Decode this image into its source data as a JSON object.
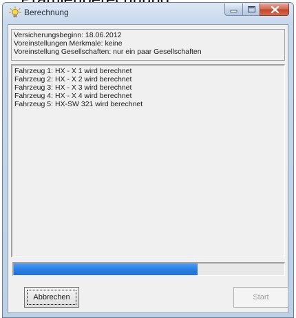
{
  "background": {
    "clipped_title": "Prämienberechnung:"
  },
  "window": {
    "title": "Berechnung",
    "icon": "lightbulb-icon",
    "controls": {
      "minimize_icon": "minimize-icon",
      "maximize_icon": "maximize-icon",
      "close_icon": "close-icon",
      "close_color": "#c7452a"
    }
  },
  "info": {
    "lines": [
      "Versicherungsbeginn: 18.06.2012",
      "Voreinstellungen Merkmale: keine",
      "Voreinstellung Gesellschaften: nur ein paar Gesellschaften"
    ]
  },
  "log": {
    "lines": [
      "Fahrzeug 1: HX - X 1 wird berechnet",
      "Fahrzeug 2: HX - X 2 wird berechnet",
      "Fahrzeug 3: HX - X 3 wird berechnet",
      "Fahrzeug 4: HX - X 4 wird berechnet",
      "Fahrzeug 5: HX-SW 321 wird berechnet"
    ]
  },
  "progress": {
    "fraction": 0.68,
    "color": "#2a7fe6"
  },
  "buttons": {
    "cancel_label": "Abbrechen",
    "start_label": "Start",
    "start_enabled": false
  }
}
